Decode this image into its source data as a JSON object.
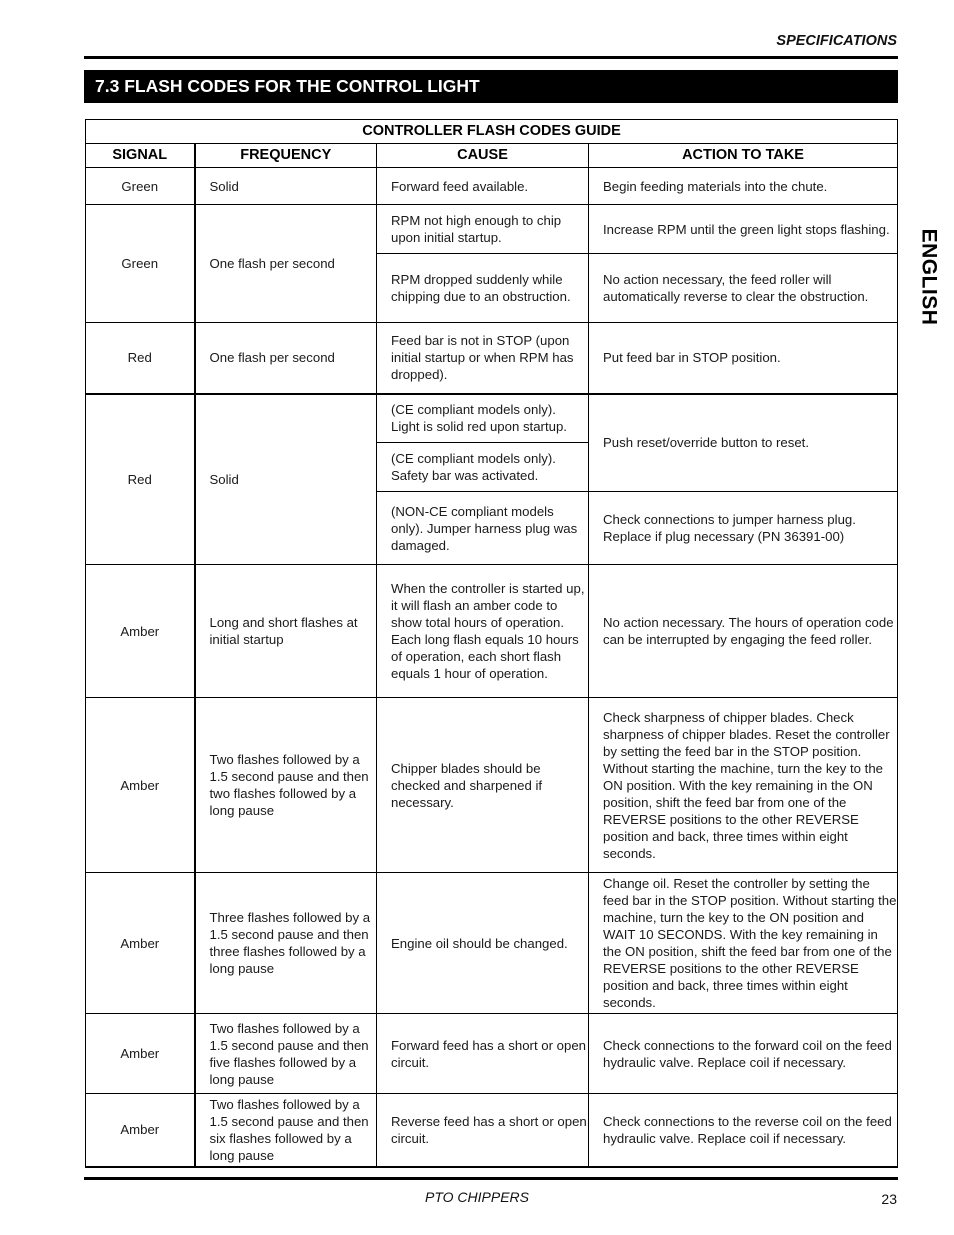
{
  "header": {
    "running_head": "SPECIFICATIONS",
    "section_title": "7.3  FLASH CODES FOR THE CONTROL LIGHT",
    "side_tab": "ENGLISH"
  },
  "table": {
    "caption": "CONTROLLER FLASH CODES GUIDE",
    "columns": [
      "SIGNAL",
      "FREQUENCY",
      "CAUSE",
      "ACTION TO TAKE"
    ],
    "rows": [
      {
        "signal": "Green",
        "frequency": "Solid",
        "entries": [
          {
            "cause": "Forward feed available.",
            "action": "Begin feeding materials into the chute."
          }
        ]
      },
      {
        "signal": "Green",
        "frequency": "One flash per second",
        "entries": [
          {
            "cause": "RPM not high enough to chip upon initial startup.",
            "action": "Increase RPM until the green light stops flashing."
          },
          {
            "cause": "RPM dropped suddenly while chipping due to an obstruction.",
            "action": "No action necessary, the feed roller will automatically reverse to clear the obstruction."
          }
        ]
      },
      {
        "signal": "Red",
        "frequency": "One flash per second",
        "entries": [
          {
            "cause": "Feed bar is not in STOP (upon initial startup or when RPM has dropped).",
            "action": "Put feed bar in STOP position."
          }
        ]
      },
      {
        "signal": "Red",
        "frequency": "Solid",
        "entries": [
          {
            "cause": "(CE compliant models only). Light is solid red upon startup.",
            "action": "Push reset/override button to reset."
          },
          {
            "cause": "(CE compliant models only). Safety bar was activated.",
            "action": null
          },
          {
            "cause": "(NON-CE compliant models only). Jumper harness plug was damaged.",
            "action": "Check connections to jumper harness plug. Replace if plug necessary (PN 36391-00)"
          }
        ]
      },
      {
        "signal": "Amber",
        "frequency": "Long and short flashes at initial startup",
        "entries": [
          {
            "cause": "When the controller is started up, it will flash an amber code to show total hours of operation. Each long flash equals 10 hours of operation, each short flash equals 1 hour of operation.",
            "action": "No action necessary. The hours of operation code can be interrupted by engaging the feed roller."
          }
        ]
      },
      {
        "signal": "Amber",
        "frequency": "Two flashes followed by a 1.5 second pause and then two flashes followed by a long pause",
        "entries": [
          {
            "cause": "Chipper blades should be checked and sharpened if necessary.",
            "action": "Check sharpness of chipper blades. Check sharpness of chipper blades. Reset the controller by setting the feed bar in the STOP position. Without starting the machine, turn the key to the ON position. With the key remaining in the ON position, shift the feed bar from one of the REVERSE positions to the other REVERSE position and back, three times within eight seconds."
          }
        ]
      },
      {
        "signal": "Amber",
        "frequency": "Three flashes followed by a 1.5 second pause and then three flashes followed by a long pause",
        "entries": [
          {
            "cause": "Engine oil should be changed.",
            "action": "Change oil. Reset the controller by setting the feed bar in the STOP position. Without starting the machine, turn the key to the ON position and WAIT 10 SECONDS. With the key remaining in the ON position, shift the feed bar from one of the REVERSE positions to the other REVERSE position and back, three times within eight seconds."
          }
        ]
      },
      {
        "signal": "Amber",
        "frequency": "Two flashes followed by a 1.5 second pause and then five flashes followed by a long pause",
        "entries": [
          {
            "cause": "Forward feed has a short or open circuit.",
            "action": "Check connections to the forward coil on the feed hydraulic valve. Replace coil if necessary."
          }
        ]
      },
      {
        "signal": "Amber",
        "frequency": "Two flashes followed by a 1.5 second pause and then six flashes followed by a long pause",
        "entries": [
          {
            "cause": "Reverse feed has a short or open circuit.",
            "action": "Check connections to the reverse coil on the feed hydraulic valve. Replace coil if necessary."
          }
        ]
      }
    ]
  },
  "footer": {
    "title": "PTO CHIPPERS",
    "page_number": "23"
  }
}
